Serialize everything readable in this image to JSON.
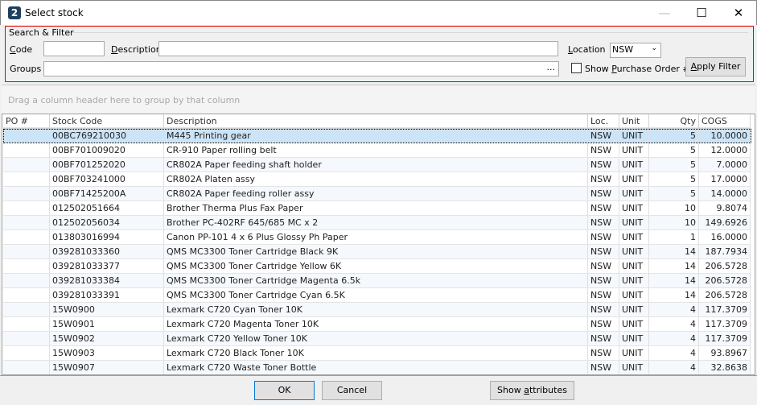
{
  "window": {
    "title": "Select stock",
    "icon": "app-logo-icon"
  },
  "filter": {
    "legend": "Search & Filter",
    "code_label": "Code",
    "code_value": "",
    "description_label": "Description",
    "description_value": "",
    "location_label": "Location",
    "location_value": "NSW",
    "groups_label": "Groups",
    "groups_value": "",
    "groups_button": "...",
    "show_po_label": "Show Purchase Order #",
    "show_po_checked": false,
    "apply_label": "Apply Filter"
  },
  "group_panel_hint": "Drag a column header here to group by that column",
  "grid": {
    "columns": [
      "PO #",
      "Stock Code",
      "Description",
      "Loc.",
      "Unit",
      "Qty",
      "COGS"
    ],
    "rows": [
      [
        "",
        "00BC769210030",
        "M445 Printing gear",
        "NSW",
        "UNIT",
        "5",
        "10.0000"
      ],
      [
        "",
        "00BF701009020",
        "CR-910 Paper rolling belt",
        "NSW",
        "UNIT",
        "5",
        "12.0000"
      ],
      [
        "",
        "00BF701252020",
        "CR802A Paper feeding shaft holder",
        "NSW",
        "UNIT",
        "5",
        "7.0000"
      ],
      [
        "",
        "00BF703241000",
        "CR802A Platen assy",
        "NSW",
        "UNIT",
        "5",
        "17.0000"
      ],
      [
        "",
        "00BF71425200A",
        "CR802A Paper feeding roller assy",
        "NSW",
        "UNIT",
        "5",
        "14.0000"
      ],
      [
        "",
        "012502051664",
        "Brother Therma Plus Fax Paper",
        "NSW",
        "UNIT",
        "10",
        "9.8074"
      ],
      [
        "",
        "012502056034",
        "Brother PC-402RF 645/685 MC  x 2",
        "NSW",
        "UNIT",
        "10",
        "149.6926"
      ],
      [
        "",
        "013803016994",
        "Canon PP-101  4 x 6 Plus Glossy Ph Paper",
        "NSW",
        "UNIT",
        "1",
        "16.0000"
      ],
      [
        "",
        "039281033360",
        "QMS MC3300 Toner Cartridge Black 9K",
        "NSW",
        "UNIT",
        "14",
        "187.7934"
      ],
      [
        "",
        "039281033377",
        "QMS MC3300 Toner Cartridge Yellow 6K",
        "NSW",
        "UNIT",
        "14",
        "206.5728"
      ],
      [
        "",
        "039281033384",
        "QMS MC3300 Toner Cartridge Magenta 6.5k",
        "NSW",
        "UNIT",
        "14",
        "206.5728"
      ],
      [
        "",
        "039281033391",
        "QMS MC3300 Toner Cartridge Cyan 6.5K",
        "NSW",
        "UNIT",
        "14",
        "206.5728"
      ],
      [
        "",
        "15W0900",
        "Lexmark C720 Cyan Toner 10K",
        "NSW",
        "UNIT",
        "4",
        "117.3709"
      ],
      [
        "",
        "15W0901",
        "Lexmark C720 Magenta Toner 10K",
        "NSW",
        "UNIT",
        "4",
        "117.3709"
      ],
      [
        "",
        "15W0902",
        "Lexmark C720 Yellow Toner 10K",
        "NSW",
        "UNIT",
        "4",
        "117.3709"
      ],
      [
        "",
        "15W0903",
        "Lexmark C720 Black Toner 10K",
        "NSW",
        "UNIT",
        "4",
        "93.8967"
      ],
      [
        "",
        "15W0907",
        "Lexmark C720 Waste Toner Bottle",
        "NSW",
        "UNIT",
        "4",
        "32.8638"
      ]
    ],
    "selected_row": 0
  },
  "footer": {
    "ok": "OK",
    "cancel": "Cancel",
    "show_attributes": "Show attributes"
  },
  "colors": {
    "selection": "#cce4f7",
    "filter_border": "#e00000",
    "focus_border": "#0078d7"
  }
}
